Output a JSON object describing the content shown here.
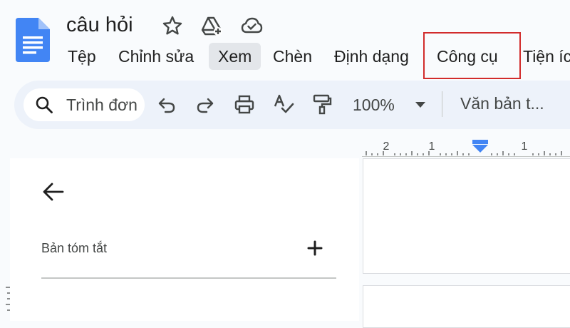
{
  "header": {
    "doc_title": "câu hỏi",
    "icons": [
      "star-icon",
      "move-to-drive-icon",
      "cloud-saved-icon"
    ]
  },
  "menu": {
    "items": [
      "Tệp",
      "Chỉnh sửa",
      "Xem",
      "Chèn",
      "Định dạng",
      "Công cụ",
      "Tiện íc"
    ],
    "active_item": "Xem",
    "highlighted_item": "Công cụ"
  },
  "toolbar": {
    "search_placeholder": "Trình đơn",
    "zoom": "100%",
    "style": "Văn bản t...",
    "icons": [
      "undo-icon",
      "redo-icon",
      "print-icon",
      "spellcheck-icon",
      "paint-format-icon"
    ]
  },
  "ruler": {
    "labels": [
      "2",
      "1",
      "1"
    ]
  },
  "outline": {
    "summary_label": "Bản tóm tắt"
  },
  "colors": {
    "accent_blue": "#4285f4",
    "highlight_red": "#d22c2c",
    "toolbar_bg": "#edf2fa",
    "active_menu_bg": "#e3e6ea"
  }
}
